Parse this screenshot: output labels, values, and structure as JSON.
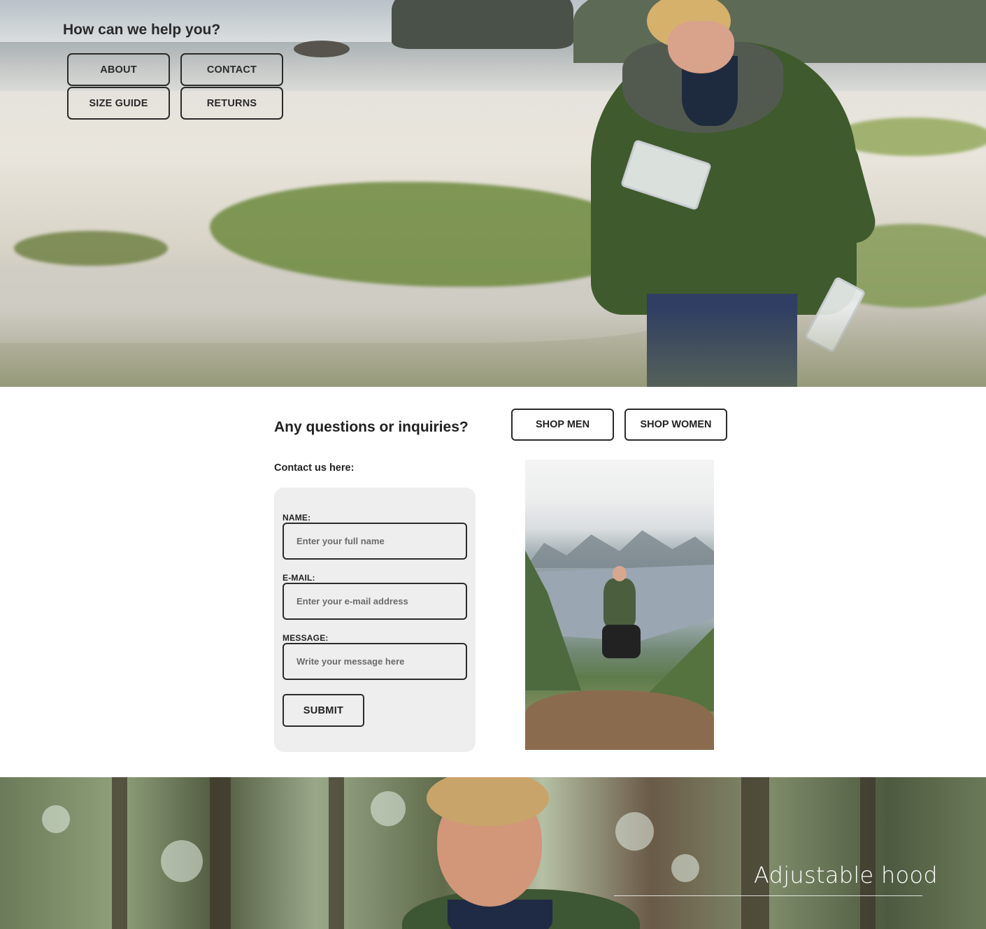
{
  "help_section": {
    "title": "How can we help you?",
    "buttons": [
      {
        "label": "ABOUT"
      },
      {
        "label": "CONTACT"
      },
      {
        "label": "SIZE GUIDE"
      },
      {
        "label": "RETURNS"
      }
    ]
  },
  "inquiry_section": {
    "title": "Any questions or inquiries?",
    "shop_buttons": [
      {
        "label": "SHOP MEN"
      },
      {
        "label": "SHOP WOMEN"
      }
    ],
    "contact_label": "Contact us here:"
  },
  "contact_form": {
    "name_label": "NAME:",
    "name_placeholder": "Enter your full name",
    "email_label": "E-MAIL:",
    "email_placeholder": "Enter your e-mail address",
    "message_label": "MESSAGE:",
    "message_placeholder": "Write your message here",
    "submit_label": "SUBMIT"
  },
  "feature": {
    "text": "Adjustable hood"
  },
  "colors": {
    "text": "#2b2b2b",
    "form_background": "#eeeeee",
    "page_background": "#ffffff"
  }
}
